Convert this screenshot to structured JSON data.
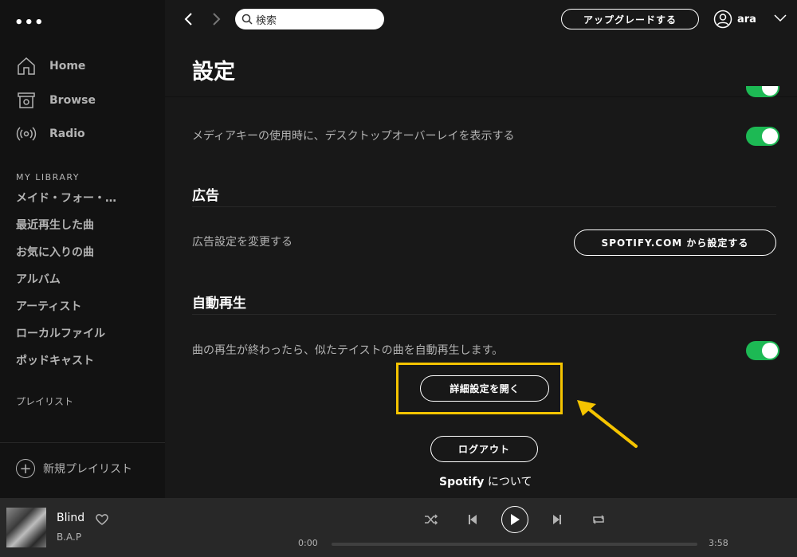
{
  "sidebar": {
    "menu_dots": "•••",
    "nav": [
      {
        "label": "Home",
        "icon": "home-icon"
      },
      {
        "label": "Browse",
        "icon": "browse-icon"
      },
      {
        "label": "Radio",
        "icon": "radio-icon"
      }
    ],
    "library_title": "MY LIBRARY",
    "library_items": [
      "メイド・フォー・…",
      "最近再生した曲",
      "お気に入りの曲",
      "アルバム",
      "アーティスト",
      "ローカルファイル",
      "ポッドキャスト"
    ],
    "playlists_title": "プレイリスト",
    "new_playlist": "新規プレイリスト"
  },
  "topbar": {
    "search_value": "検索",
    "upgrade_label": "アップグレードする",
    "username": "ara"
  },
  "settings": {
    "page_title": "設定",
    "media_key_overlay": "メディアキーの使用時に、デスクトップオーバーレイを表示する",
    "ads_title": "広告",
    "ads_text": "広告設定を変更する",
    "ads_button": "SPOTIFY.COM から設定する",
    "autoplay_title": "自動再生",
    "autoplay_text": "曲の再生が終わったら、似たテイストの曲を自動再生します。",
    "advanced_button": "詳細設定を開く",
    "logout_button": "ログアウト",
    "about_brand": "Spotify",
    "about_suffix": " について"
  },
  "player": {
    "track": "Blind",
    "artist": "B.A.P",
    "time_current": "0:00",
    "time_total": "3:58",
    "progress": 0.0
  },
  "colors": {
    "accent": "#1db954",
    "highlight": "#f5c400",
    "background": "#181818",
    "sidebar": "#121212",
    "player": "#282828"
  }
}
